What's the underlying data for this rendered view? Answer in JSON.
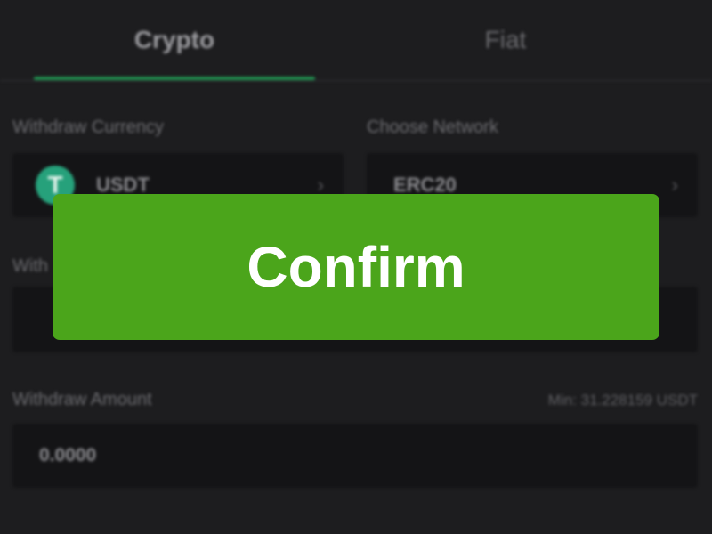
{
  "tabs": [
    {
      "label": "Crypto",
      "active": true
    },
    {
      "label": "Fiat",
      "active": false
    }
  ],
  "withdraw_currency": {
    "label": "Withdraw Currency",
    "value": "USDT",
    "icon": "tether-icon",
    "icon_glyph": "T",
    "icon_color": "#26a17b"
  },
  "network": {
    "label": "Choose Network",
    "value": "ERC20"
  },
  "address": {
    "label_partial": "With"
  },
  "amount": {
    "label": "Withdraw Amount",
    "min_text": "Min: 31.228159 USDT",
    "value": "0.0000"
  },
  "confirm": {
    "label": "Confirm",
    "color": "#4ba51b"
  },
  "colors": {
    "accent": "#1f8f4e",
    "background": "#1d1d1f"
  },
  "chevron_glyph": "›"
}
